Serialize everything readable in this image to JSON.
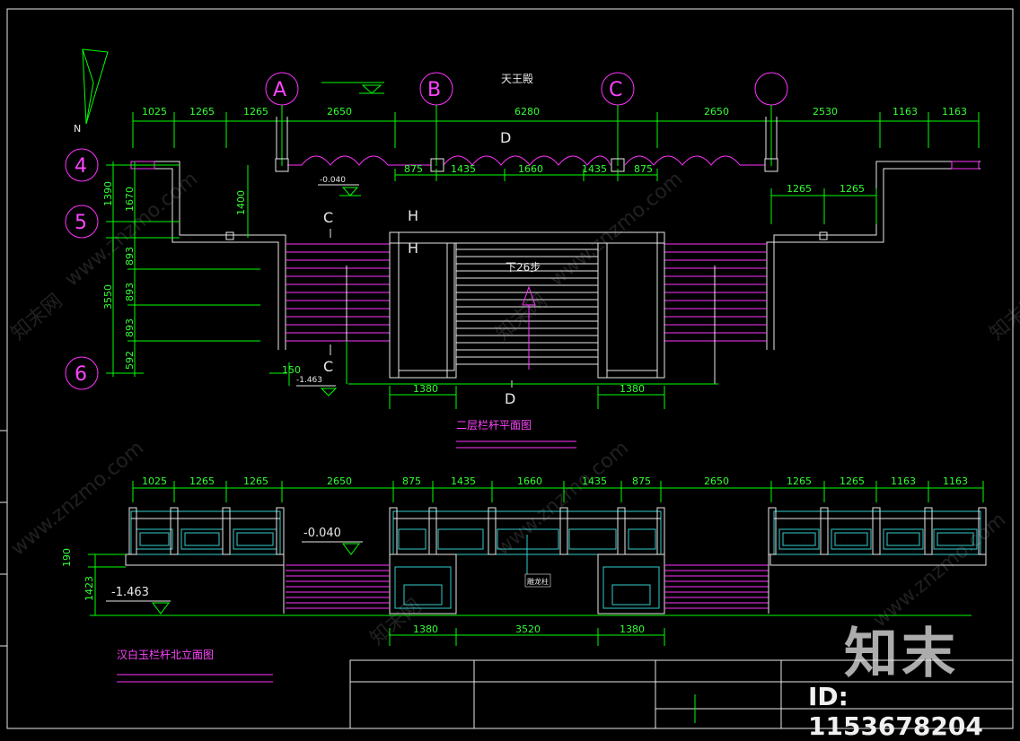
{
  "plan": {
    "title": "天王殿",
    "caption": "二层栏杆平面图",
    "grid_letters": [
      "A",
      "B",
      "C"
    ],
    "grid_numbers": [
      "4",
      "5",
      "6"
    ],
    "top_dims": [
      "1025",
      "1265",
      "1265",
      "2650",
      "6280",
      "2650",
      "2530",
      "1163",
      "1163"
    ],
    "inner_dims": [
      "875",
      "1435",
      "1660",
      "1435",
      "875"
    ],
    "left_dims": [
      "1390",
      "1670",
      "893",
      "893",
      "893",
      "592"
    ],
    "left_total": "3550",
    "dim_1400": "1400",
    "right_dims": [
      "1265",
      "1265"
    ],
    "bottom_dims": [
      "1380",
      "1380"
    ],
    "dim_150": "150",
    "level_1": "-0.040",
    "level_2": "-1.463",
    "section_labels": [
      "C",
      "C",
      "D",
      "D",
      "H",
      "H"
    ],
    "stair_note": "下26步"
  },
  "elevation": {
    "caption": "汉白玉栏杆北立面图",
    "top_dims": [
      "1025",
      "1265",
      "1265",
      "2650",
      "875",
      "1435",
      "1660",
      "1435",
      "875",
      "2650",
      "1265",
      "1265",
      "1163",
      "1163"
    ],
    "level_1": "-0.040",
    "level_2": "-1.463",
    "dim_190": "190",
    "dim_1423": "1423",
    "bottom_dims": [
      "1380",
      "3520",
      "1380"
    ],
    "center_label": "雕龙柱"
  },
  "watermark": {
    "site": "www.znzmo.com",
    "cn": "知末网",
    "brand": "知末",
    "id": "ID: 1153678204"
  }
}
